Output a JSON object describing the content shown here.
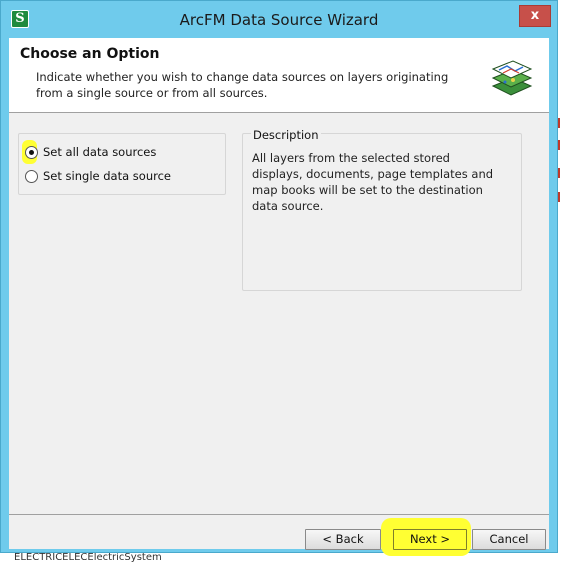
{
  "window": {
    "title": "ArcFM Data Source Wizard",
    "close_label": "x"
  },
  "header": {
    "title": "Choose an Option",
    "description": "Indicate whether you wish to change data sources on layers originating from a single source or from all sources."
  },
  "options": [
    {
      "label": "Set all data sources",
      "checked": true,
      "highlighted": true
    },
    {
      "label": "Set single data source",
      "checked": false,
      "highlighted": false
    }
  ],
  "description_panel": {
    "title": "Description",
    "text": "All layers from the selected stored displays, documents, page templates and map books will be set to the destination data source."
  },
  "buttons": {
    "back": "< Back",
    "next": "Next >",
    "cancel": "Cancel"
  },
  "background": {
    "status_text": "ELECTRICELECElectricSystem"
  },
  "colors": {
    "titlebar": "#6fcbec",
    "close_button": "#c7504a",
    "highlight": "#ffff33",
    "panel": "#f0f0f0"
  },
  "icons": {
    "app_icon": "arcfm-s-icon",
    "header_logo": "map-layers-icon"
  }
}
